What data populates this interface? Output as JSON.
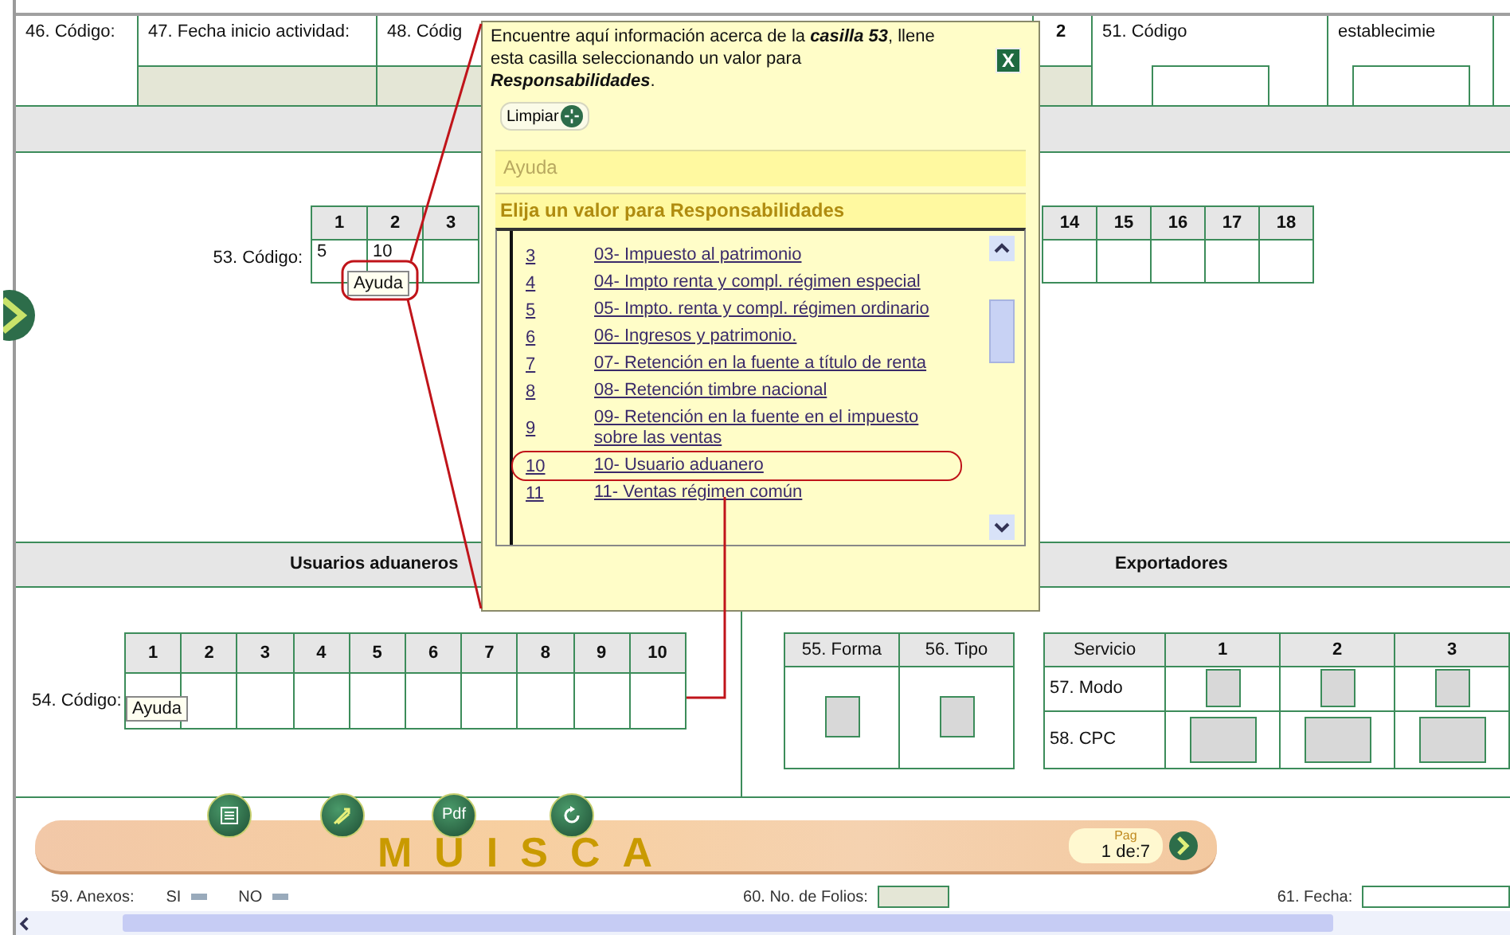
{
  "top_row": [
    {
      "label": "46. Código:",
      "kind": "plain"
    },
    {
      "label": "47. Fecha inicio actividad:",
      "kind": "shaded"
    },
    {
      "label": "48. Códig",
      "kind": "shaded"
    },
    {
      "label": "2",
      "kind": "shaded"
    },
    {
      "label": "51. Código",
      "kind": "boxed"
    },
    {
      "label": "establecimie",
      "kind": "boxed"
    }
  ],
  "section_53": {
    "label": "53. Código:",
    "columns_left": [
      {
        "header": "1",
        "value": "5"
      },
      {
        "header": "2",
        "value": "10"
      },
      {
        "header": "3"
      }
    ],
    "columns_right": [
      {
        "header": "14"
      },
      {
        "header": "15"
      },
      {
        "header": "16"
      },
      {
        "header": "17"
      },
      {
        "header": "18"
      }
    ],
    "tooltip": "Ayuda"
  },
  "section_titles": [
    "Usuarios aduaneros",
    "Exportadores"
  ],
  "section_54": {
    "label": "54. Código:",
    "columns": [
      "1",
      "2",
      "3",
      "4",
      "5",
      "6",
      "7",
      "8",
      "9",
      "10"
    ],
    "tooltip": "Ayuda"
  },
  "forma_tipo": {
    "columns": [
      "55. Forma",
      "56. Tipo"
    ]
  },
  "servicio": {
    "columns": [
      "Servicio",
      "1",
      "2",
      "3"
    ],
    "rows": [
      {
        "label": "57. Modo",
        "kind": "small"
      },
      {
        "label": "58. CPC",
        "kind": "wide"
      }
    ]
  },
  "toolbar": {
    "buttons": [
      {
        "kind": "list"
      },
      {
        "kind": "wand"
      },
      {
        "kind": "pdf",
        "label": "Pdf"
      },
      {
        "kind": "refresh"
      }
    ],
    "logo": "MUISCA",
    "page_label": "Pag",
    "page": "1 de:7"
  },
  "bottom_row": {
    "anexos": "59. Anexos:",
    "options": [
      {
        "label": "SI",
        "selected": false
      },
      {
        "label": "NO",
        "selected": false
      }
    ],
    "folios": "60. No. de Folios:",
    "fecha": "61. Fecha:"
  },
  "popup": {
    "message": "Encuentre aquí información acerca de la **casilla 53**, llene esta casilla seleccionando un valor para **Responsabilidades**.",
    "close": "X",
    "clear_button": "Limpiar",
    "help_header": "Ayuda",
    "list_title": "Elija un valor para Responsabilidades",
    "options": [
      {
        "code": "3",
        "label": "03- Impuesto al patrimonio",
        "highlighted": false
      },
      {
        "code": "4",
        "label": "04- Impto renta y compl. régimen especial",
        "highlighted": false
      },
      {
        "code": "5",
        "label": "05- Impto. renta y compl. régimen ordinario",
        "highlighted": false
      },
      {
        "code": "6",
        "label": "06- Ingresos y patrimonio.",
        "highlighted": false
      },
      {
        "code": "7",
        "label": "07- Retención en la fuente a título de renta",
        "highlighted": false
      },
      {
        "code": "8",
        "label": "08- Retención timbre nacional",
        "highlighted": false
      },
      {
        "code": "9",
        "label": "09- Retención en la fuente en el impuesto sobre las ventas",
        "highlighted": false
      },
      {
        "code": "10",
        "label": "10- Usuario aduanero",
        "highlighted": true
      },
      {
        "code": "11",
        "label": "11- Ventas régimen común",
        "highlighted": false
      }
    ]
  }
}
